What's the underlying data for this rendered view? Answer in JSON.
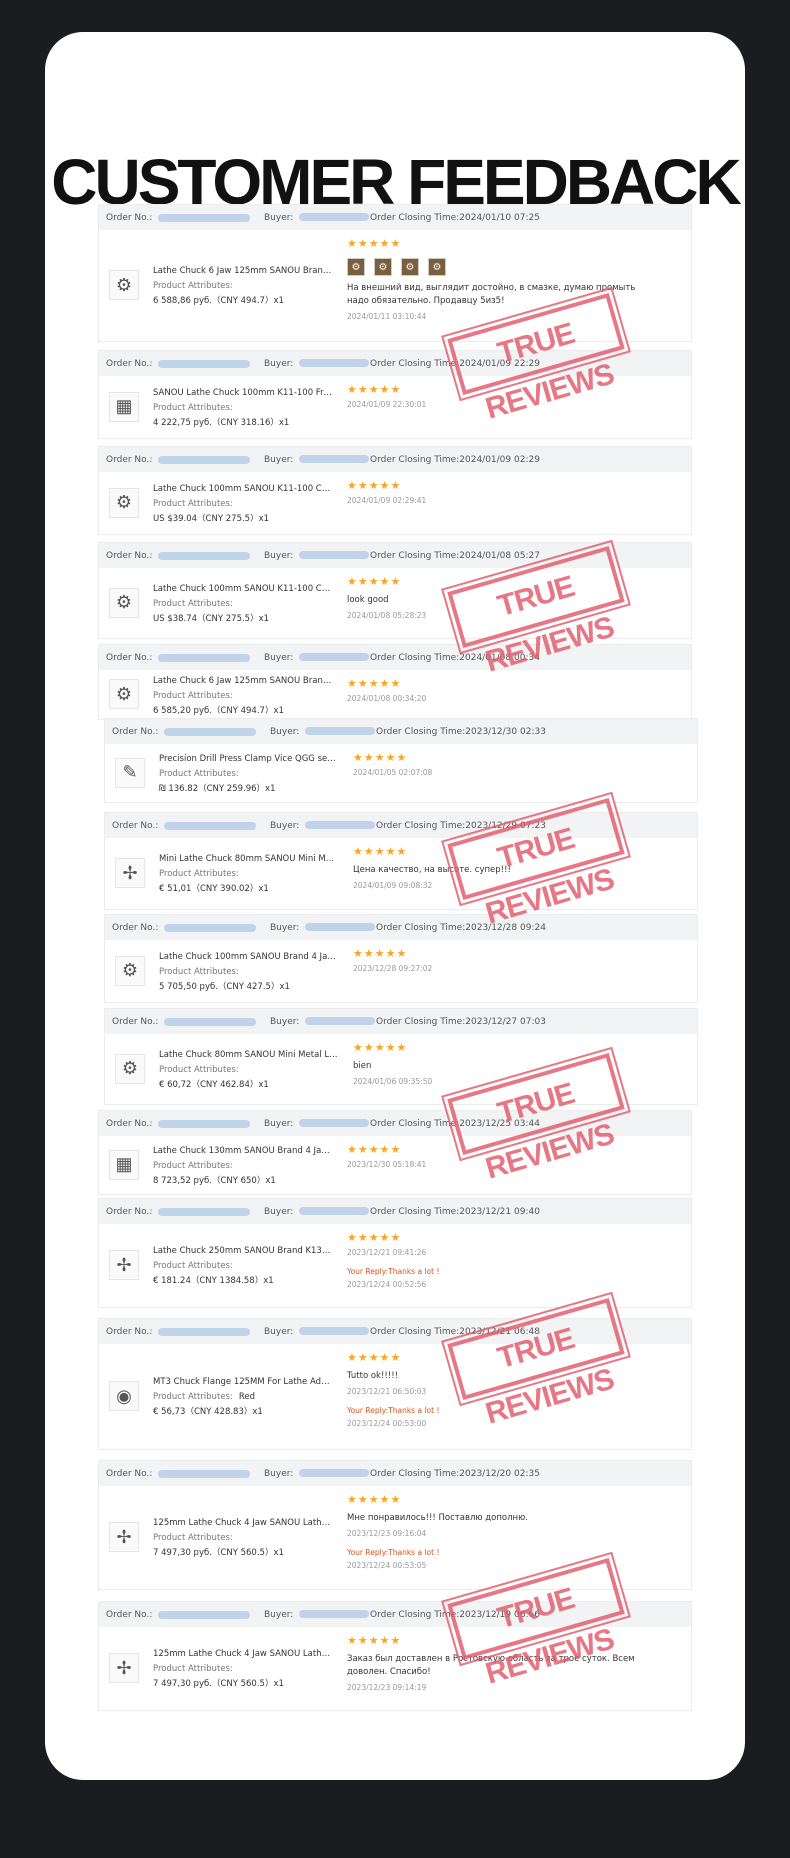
{
  "title": "CUSTOMER FEEDBACK",
  "labels": {
    "order_no": "Order No.:",
    "buyer": "Buyer:",
    "closing": "Order Closing Time:",
    "attributes": "Product Attributes:"
  },
  "stamp_text": "TRUE REVIEWS",
  "orders": [
    {
      "closing": "2024/01/10 07:25",
      "product": "Lathe Chuck 6 Jaw 125mm SANOU Brand S...",
      "price": "6 588,86 руб.（CNY  494.7）x1",
      "stars": "★★★★★",
      "review": "На внешний вид, выглядит достойно, в смазке, думаю промыть надо обязательно. Продавцу 5из5!",
      "review_date": "2024/01/11 03:10:44",
      "reply": "",
      "reply_date": ""
    },
    {
      "closing": "2024/01/09 22:29",
      "product": "SANOU Lathe Chuck 100mm K11-100 Front...",
      "price": "4 222,75 руб.（CNY  318.16）x1",
      "stars": "★★★★★",
      "review": "",
      "review_date": "2024/01/09 22:30:01",
      "reply": "",
      "reply_date": ""
    },
    {
      "closing": "2024/01/09 02:29",
      "product": "Lathe Chuck 100mm SANOU K11-100 Chuc...",
      "price": "US $39.04（CNY  275.5）x1",
      "stars": "★★★★★",
      "review": "",
      "review_date": "2024/01/09 02:29:41",
      "reply": "",
      "reply_date": ""
    },
    {
      "closing": "2024/01/08 05:27",
      "product": "Lathe Chuck 100mm SANOU K11-100 Chuc...",
      "price": "US $38.74（CNY  275.5）x1",
      "stars": "★★★★★",
      "review": "look good",
      "review_date": "2024/01/08 05:28:23",
      "reply": "",
      "reply_date": ""
    },
    {
      "closing": "2024/01/08 00:34",
      "product": "Lathe Chuck 6 Jaw 125mm SANOU Brand S...",
      "price": "6 585,20 руб.（CNY  494.7）x1",
      "stars": "★★★★★",
      "review": "",
      "review_date": "2024/01/08 00:34:20",
      "reply": "",
      "reply_date": ""
    },
    {
      "closing": "2023/12/30 02:33",
      "product": "Precision Drill Press Clamp Vice QGG series...",
      "price": "₪ 136.82（CNY  259.96）x1",
      "stars": "★★★★★",
      "review": "",
      "review_date": "2024/01/05 02:07:08",
      "reply": "",
      "reply_date": ""
    },
    {
      "closing": "2023/12/29 07:23",
      "product": "Mini Lathe Chuck 80mm SANOU Mini Meta...",
      "price": "€ 51,01（CNY  390.02）x1",
      "stars": "★★★★★",
      "review": "Цена качество, на высоте. супер!!!",
      "review_date": "2024/01/09 09:08:32",
      "reply": "",
      "reply_date": ""
    },
    {
      "closing": "2023/12/28 09:24",
      "product": "Lathe Chuck 100mm SANOU Brand 4 Jaw C...",
      "price": "5 705,50 руб.（CNY  427.5）x1",
      "stars": "★★★★★",
      "review": "",
      "review_date": "2023/12/28 09:27:02",
      "reply": "",
      "reply_date": ""
    },
    {
      "closing": "2023/12/27 07:03",
      "product": "Lathe Chuck 80mm SANOU Mini Metal Lat...",
      "price": "€ 60,72（CNY  462.84）x1",
      "stars": "★★★★★",
      "review": "bien",
      "review_date": "2024/01/06 09:35:50",
      "reply": "",
      "reply_date": ""
    },
    {
      "closing": "2023/12/25 03:44",
      "product": "Lathe Chuck 130mm SANOU Brand 4 Jaw S...",
      "price": "8 723,52 руб.（CNY  650）x1",
      "stars": "★★★★★",
      "review": "",
      "review_date": "2023/12/30 05:18:41",
      "reply": "",
      "reply_date": ""
    },
    {
      "closing": "2023/12/21 09:40",
      "product": "Lathe Chuck 250mm SANOU Brand K13-25...",
      "price": "€ 181.24（CNY  1384.58）x1",
      "stars": "★★★★★",
      "review": "",
      "review_date": "2023/12/21 09:41:26",
      "reply": "Your Reply:Thanks a lot !",
      "reply_date": "2023/12/24 00:52:56"
    },
    {
      "closing": "2023/12/21 06:48",
      "product": "MT3 Chuck Flange 125MM For Lathe Adapt...",
      "attr_value": "Red",
      "price": "€ 56,73（CNY  428.83）x1",
      "stars": "★★★★★",
      "review": "Tutto ok!!!!!",
      "review_date": "2023/12/21 06:50:03",
      "reply": "Your Reply:Thanks a lot !",
      "reply_date": "2023/12/24 00:53:00"
    },
    {
      "closing": "2023/12/20 02:35",
      "product": "125mm Lathe Chuck 4 Jaw SANOU Lathe S...",
      "price": "7 497,30 руб.（CNY  560.5）x1",
      "stars": "★★★★★",
      "review": "Мне понравилось!!! Поставлю дополню.",
      "review_date": "2023/12/23 09:16:04",
      "reply": "Your Reply:Thanks a lot !",
      "reply_date": "2023/12/24 00:53:05"
    },
    {
      "closing": "2023/12/19 06:66",
      "product": "125mm Lathe Chuck 4 Jaw SANOU Lathe S...",
      "price": "7 497,30 руб.（CNY  560.5）x1",
      "stars": "★★★★★",
      "review": "Заказ был доставлен в Ростовскую область за трое суток. Всем доволен. Спасибо!",
      "review_date": "2023/12/23 09:14:19",
      "reply": "",
      "reply_date": ""
    }
  ]
}
